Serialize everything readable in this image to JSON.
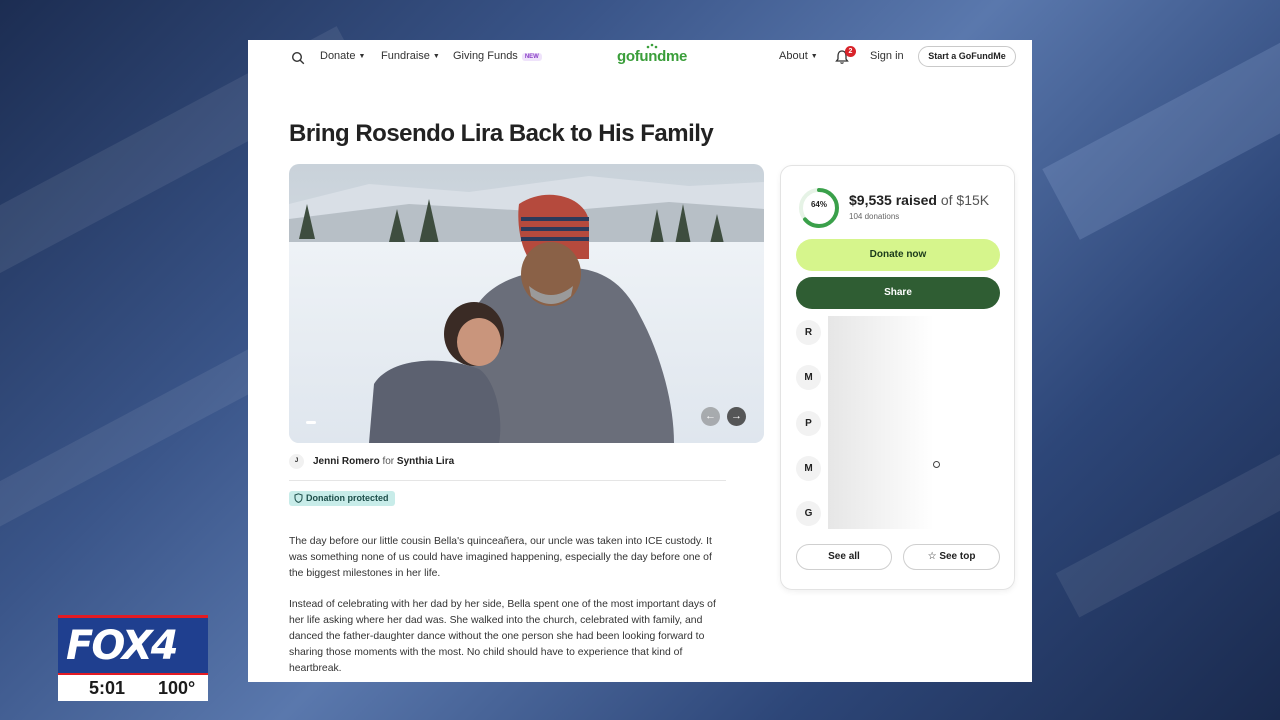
{
  "nav": {
    "donate": "Donate",
    "fundraise": "Fundraise",
    "giving_funds": "Giving Funds",
    "new_badge": "NEW",
    "logo": "gofundme",
    "about": "About",
    "notifications_count": "2",
    "sign_in": "Sign in",
    "start": "Start a GoFundMe"
  },
  "campaign": {
    "title": "Bring Rosendo Lira Back to His Family",
    "organizer_initial": "J",
    "organizer": "Jenni Romero",
    "for_word": "for",
    "beneficiary": "Synthia Lira",
    "protected_label": "Donation protected",
    "story_p1": "The day before our little cousin Bella's quinceañera, our uncle was taken into ICE custody. It was something none of us could have imagined happening, especially the day before one of the biggest milestones in her life.",
    "story_p2": "Instead of celebrating with her dad by her side, Bella spent one of the most important days of her life asking where her dad was. She walked into the church, celebrated with family, and danced the father-daughter dance without the one person she had been looking forward to sharing those moments with the most. No child should have to experience that kind of heartbreak."
  },
  "progress": {
    "percent_label": "64%",
    "fraction": 0.64,
    "raised": "$9,535 raised",
    "of_goal": "of $15K",
    "donations": "104 donations"
  },
  "card": {
    "donate_now": "Donate now",
    "share": "Share",
    "donor_initials": [
      "R",
      "M",
      "P",
      "M",
      "G"
    ],
    "see_all": "See all",
    "see_top": "See top"
  },
  "broadcast": {
    "station": "FOX4",
    "time": "5:01",
    "temperature": "100°"
  },
  "colors": {
    "brand_green": "#3a9e3a",
    "donate_button": "#d6f58c",
    "share_button": "#2f5d33",
    "fox_blue": "#1f3f8f",
    "fox_red": "#e31b23"
  }
}
